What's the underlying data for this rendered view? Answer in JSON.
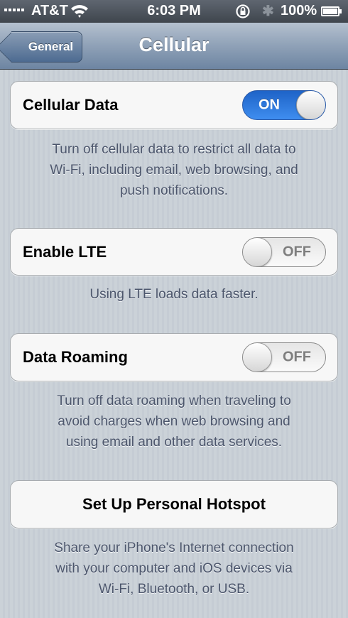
{
  "status_bar": {
    "carrier": "AT&T",
    "time": "6:03 PM",
    "battery": "100%"
  },
  "nav": {
    "back_label": "General",
    "title": "Cellular"
  },
  "cells": {
    "cellular_data": {
      "label": "Cellular Data",
      "toggle": "ON"
    },
    "enable_lte": {
      "label": "Enable LTE",
      "toggle": "OFF"
    },
    "data_roaming": {
      "label": "Data Roaming",
      "toggle": "OFF"
    },
    "hotspot": {
      "label": "Set Up Personal Hotspot"
    }
  },
  "footers": {
    "cellular_data": [
      "Turn off cellular data to restrict all data to",
      "Wi-Fi, including email, web browsing, and",
      "push notifications."
    ],
    "enable_lte": [
      "Using LTE loads data faster."
    ],
    "data_roaming": [
      "Turn off data roaming when traveling to",
      "avoid charges when web browsing and",
      "using email and other data services."
    ],
    "hotspot": [
      "Share your iPhone's Internet connection",
      "with your computer and iOS devices via",
      "Wi-Fi, Bluetooth, or USB."
    ]
  },
  "colors": {
    "toggle_on": "#2f78de",
    "footer_text": "#4c566c",
    "nav_bar": "#8fa1b7"
  }
}
